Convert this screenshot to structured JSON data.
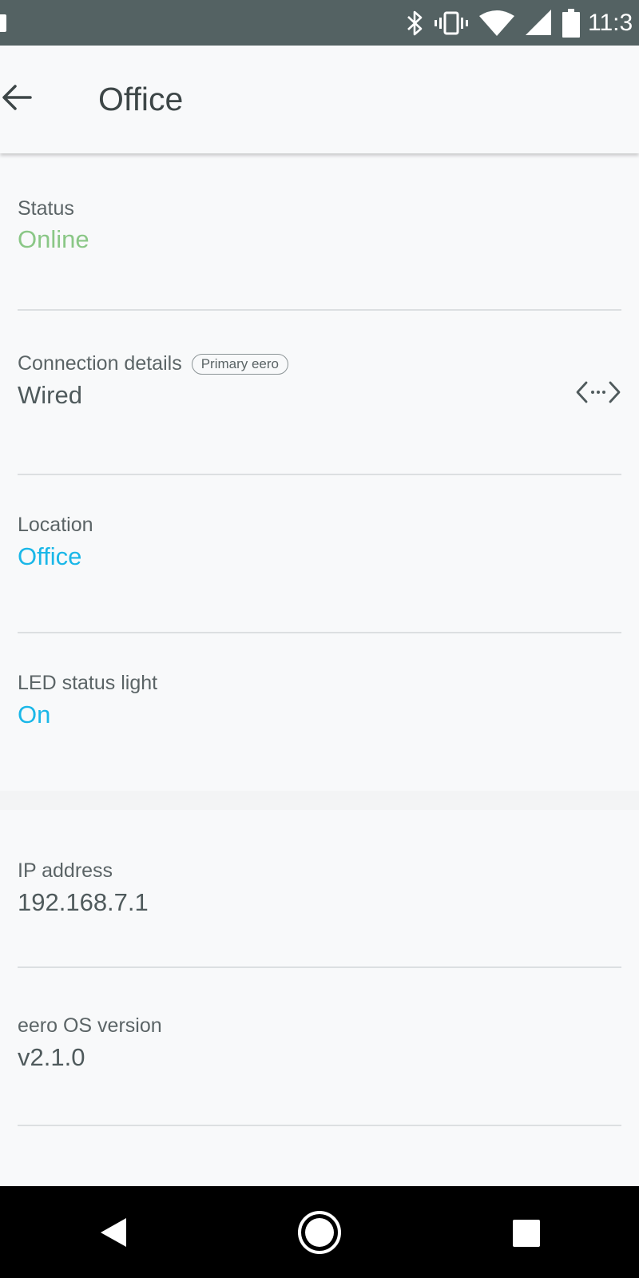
{
  "status_bar": {
    "time": "11:3",
    "icons": [
      "bluetooth-icon",
      "vibrate-icon",
      "wifi-icon",
      "cell-signal-icon",
      "battery-icon"
    ]
  },
  "app_bar": {
    "title": "Office",
    "back_icon": "arrow-left-icon"
  },
  "details": {
    "status": {
      "label": "Status",
      "value": "Online"
    },
    "connection": {
      "label": "Connection details",
      "badge": "Primary eero",
      "value": "Wired",
      "icon": "code-brackets-icon"
    },
    "location": {
      "label": "Location",
      "value": "Office"
    },
    "led": {
      "label": "LED status light",
      "value": "On"
    }
  },
  "info": {
    "ip": {
      "label": "IP address",
      "value": "192.168.7.1"
    },
    "os": {
      "label": "eero OS version",
      "value": "v2.1.0"
    }
  },
  "colors": {
    "status_bar_bg": "#546263",
    "online_green": "#8ac786",
    "link_blue": "#1ab7e8",
    "text_dark": "#3d4647"
  },
  "nav_bar": {
    "icons": [
      "back-triangle-icon",
      "home-circle-icon",
      "recents-square-icon"
    ]
  }
}
